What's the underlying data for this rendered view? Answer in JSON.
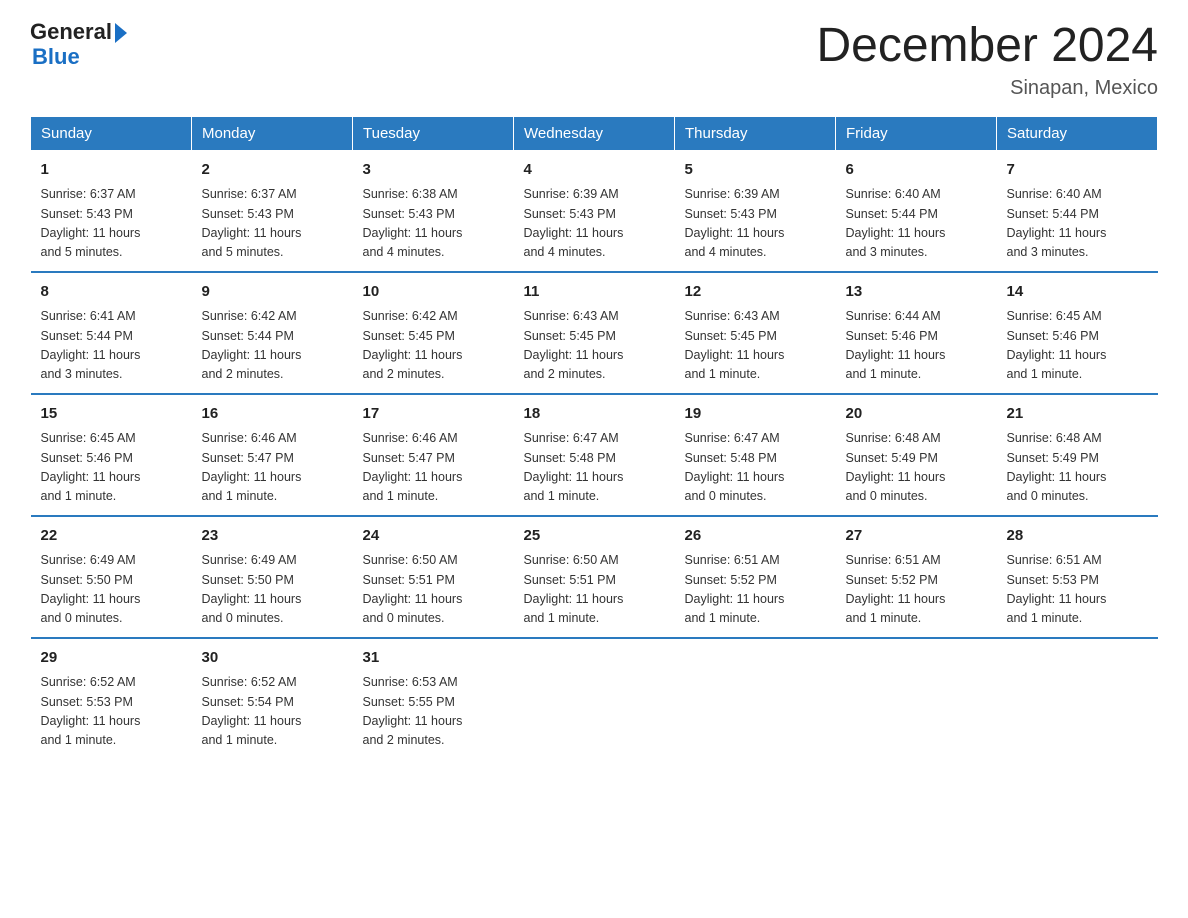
{
  "logo": {
    "text1": "General",
    "text2": "Blue"
  },
  "title": "December 2024",
  "subtitle": "Sinapan, Mexico",
  "headers": [
    "Sunday",
    "Monday",
    "Tuesday",
    "Wednesday",
    "Thursday",
    "Friday",
    "Saturday"
  ],
  "weeks": [
    [
      {
        "day": "1",
        "info": "Sunrise: 6:37 AM\nSunset: 5:43 PM\nDaylight: 11 hours\nand 5 minutes."
      },
      {
        "day": "2",
        "info": "Sunrise: 6:37 AM\nSunset: 5:43 PM\nDaylight: 11 hours\nand 5 minutes."
      },
      {
        "day": "3",
        "info": "Sunrise: 6:38 AM\nSunset: 5:43 PM\nDaylight: 11 hours\nand 4 minutes."
      },
      {
        "day": "4",
        "info": "Sunrise: 6:39 AM\nSunset: 5:43 PM\nDaylight: 11 hours\nand 4 minutes."
      },
      {
        "day": "5",
        "info": "Sunrise: 6:39 AM\nSunset: 5:43 PM\nDaylight: 11 hours\nand 4 minutes."
      },
      {
        "day": "6",
        "info": "Sunrise: 6:40 AM\nSunset: 5:44 PM\nDaylight: 11 hours\nand 3 minutes."
      },
      {
        "day": "7",
        "info": "Sunrise: 6:40 AM\nSunset: 5:44 PM\nDaylight: 11 hours\nand 3 minutes."
      }
    ],
    [
      {
        "day": "8",
        "info": "Sunrise: 6:41 AM\nSunset: 5:44 PM\nDaylight: 11 hours\nand 3 minutes."
      },
      {
        "day": "9",
        "info": "Sunrise: 6:42 AM\nSunset: 5:44 PM\nDaylight: 11 hours\nand 2 minutes."
      },
      {
        "day": "10",
        "info": "Sunrise: 6:42 AM\nSunset: 5:45 PM\nDaylight: 11 hours\nand 2 minutes."
      },
      {
        "day": "11",
        "info": "Sunrise: 6:43 AM\nSunset: 5:45 PM\nDaylight: 11 hours\nand 2 minutes."
      },
      {
        "day": "12",
        "info": "Sunrise: 6:43 AM\nSunset: 5:45 PM\nDaylight: 11 hours\nand 1 minute."
      },
      {
        "day": "13",
        "info": "Sunrise: 6:44 AM\nSunset: 5:46 PM\nDaylight: 11 hours\nand 1 minute."
      },
      {
        "day": "14",
        "info": "Sunrise: 6:45 AM\nSunset: 5:46 PM\nDaylight: 11 hours\nand 1 minute."
      }
    ],
    [
      {
        "day": "15",
        "info": "Sunrise: 6:45 AM\nSunset: 5:46 PM\nDaylight: 11 hours\nand 1 minute."
      },
      {
        "day": "16",
        "info": "Sunrise: 6:46 AM\nSunset: 5:47 PM\nDaylight: 11 hours\nand 1 minute."
      },
      {
        "day": "17",
        "info": "Sunrise: 6:46 AM\nSunset: 5:47 PM\nDaylight: 11 hours\nand 1 minute."
      },
      {
        "day": "18",
        "info": "Sunrise: 6:47 AM\nSunset: 5:48 PM\nDaylight: 11 hours\nand 1 minute."
      },
      {
        "day": "19",
        "info": "Sunrise: 6:47 AM\nSunset: 5:48 PM\nDaylight: 11 hours\nand 0 minutes."
      },
      {
        "day": "20",
        "info": "Sunrise: 6:48 AM\nSunset: 5:49 PM\nDaylight: 11 hours\nand 0 minutes."
      },
      {
        "day": "21",
        "info": "Sunrise: 6:48 AM\nSunset: 5:49 PM\nDaylight: 11 hours\nand 0 minutes."
      }
    ],
    [
      {
        "day": "22",
        "info": "Sunrise: 6:49 AM\nSunset: 5:50 PM\nDaylight: 11 hours\nand 0 minutes."
      },
      {
        "day": "23",
        "info": "Sunrise: 6:49 AM\nSunset: 5:50 PM\nDaylight: 11 hours\nand 0 minutes."
      },
      {
        "day": "24",
        "info": "Sunrise: 6:50 AM\nSunset: 5:51 PM\nDaylight: 11 hours\nand 0 minutes."
      },
      {
        "day": "25",
        "info": "Sunrise: 6:50 AM\nSunset: 5:51 PM\nDaylight: 11 hours\nand 1 minute."
      },
      {
        "day": "26",
        "info": "Sunrise: 6:51 AM\nSunset: 5:52 PM\nDaylight: 11 hours\nand 1 minute."
      },
      {
        "day": "27",
        "info": "Sunrise: 6:51 AM\nSunset: 5:52 PM\nDaylight: 11 hours\nand 1 minute."
      },
      {
        "day": "28",
        "info": "Sunrise: 6:51 AM\nSunset: 5:53 PM\nDaylight: 11 hours\nand 1 minute."
      }
    ],
    [
      {
        "day": "29",
        "info": "Sunrise: 6:52 AM\nSunset: 5:53 PM\nDaylight: 11 hours\nand 1 minute."
      },
      {
        "day": "30",
        "info": "Sunrise: 6:52 AM\nSunset: 5:54 PM\nDaylight: 11 hours\nand 1 minute."
      },
      {
        "day": "31",
        "info": "Sunrise: 6:53 AM\nSunset: 5:55 PM\nDaylight: 11 hours\nand 2 minutes."
      },
      {
        "day": "",
        "info": ""
      },
      {
        "day": "",
        "info": ""
      },
      {
        "day": "",
        "info": ""
      },
      {
        "day": "",
        "info": ""
      }
    ]
  ]
}
